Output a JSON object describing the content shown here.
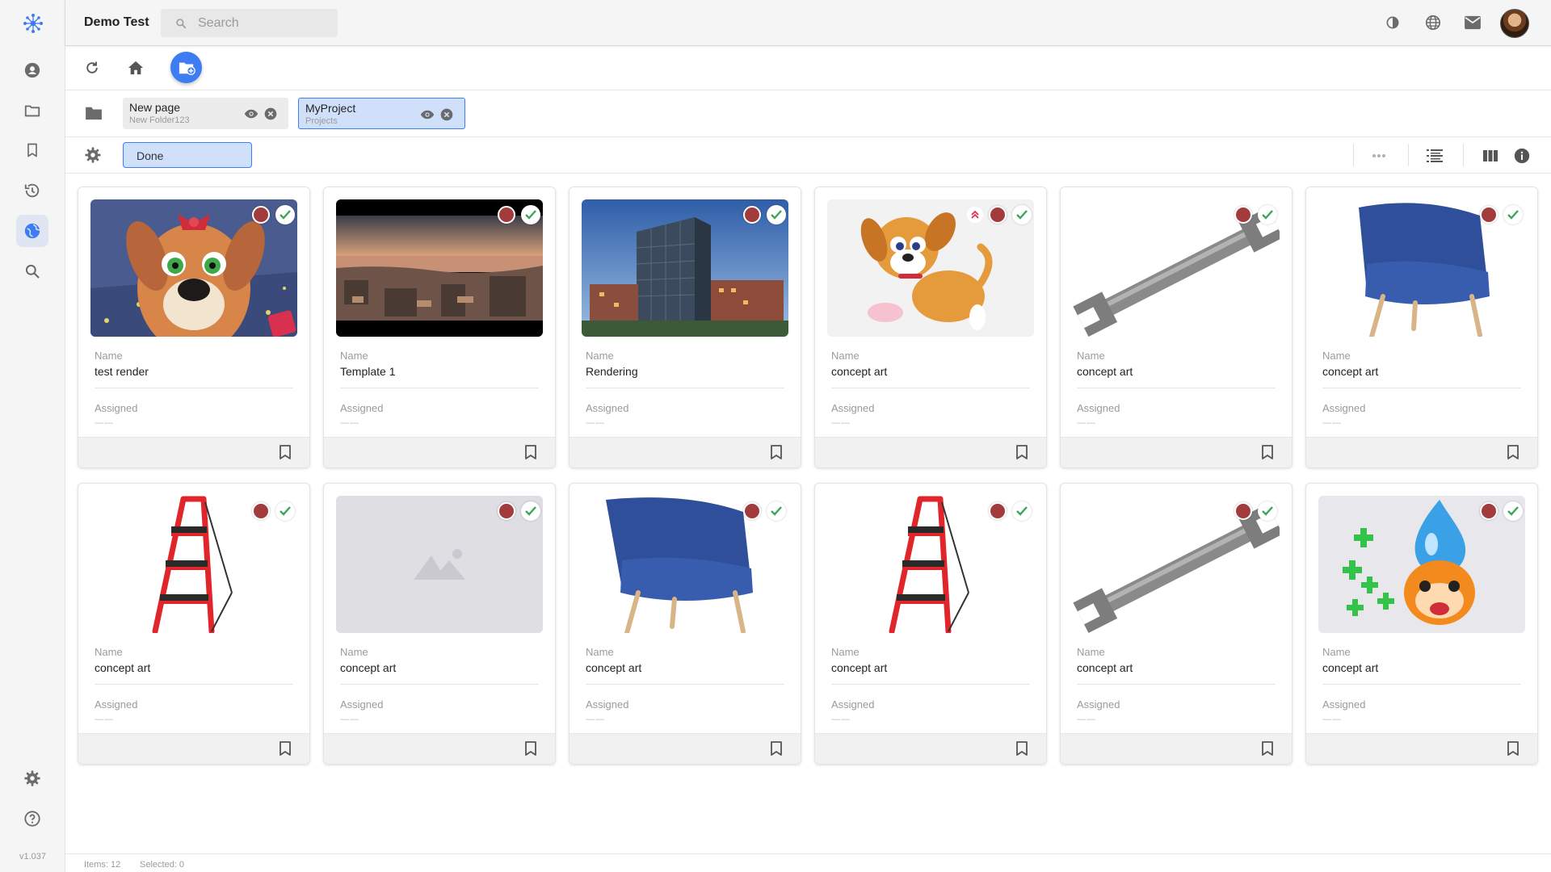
{
  "app": {
    "title": "Demo Test",
    "version": "v1.037"
  },
  "search": {
    "placeholder": "Search"
  },
  "tabs": [
    {
      "title": "New page",
      "subtitle": "New Folder123"
    },
    {
      "title": "MyProject",
      "subtitle": "Projects"
    }
  ],
  "filter": {
    "chip": "Done"
  },
  "cards": [
    {
      "name_label": "Name",
      "name": "test render",
      "assigned_label": "Assigned",
      "assigned": "——"
    },
    {
      "name_label": "Name",
      "name": "Template 1",
      "assigned_label": "Assigned",
      "assigned": "——"
    },
    {
      "name_label": "Name",
      "name": "Rendering",
      "assigned_label": "Assigned",
      "assigned": "——"
    },
    {
      "name_label": "Name",
      "name": "concept art",
      "assigned_label": "Assigned",
      "assigned": "——"
    },
    {
      "name_label": "Name",
      "name": "concept art",
      "assigned_label": "Assigned",
      "assigned": "——"
    },
    {
      "name_label": "Name",
      "name": "concept art",
      "assigned_label": "Assigned",
      "assigned": "——"
    },
    {
      "name_label": "Name",
      "name": "concept art",
      "assigned_label": "Assigned",
      "assigned": "——"
    },
    {
      "name_label": "Name",
      "name": "concept art",
      "assigned_label": "Assigned",
      "assigned": "——"
    },
    {
      "name_label": "Name",
      "name": "concept art",
      "assigned_label": "Assigned",
      "assigned": "——"
    },
    {
      "name_label": "Name",
      "name": "concept art",
      "assigned_label": "Assigned",
      "assigned": "——"
    },
    {
      "name_label": "Name",
      "name": "concept art",
      "assigned_label": "Assigned",
      "assigned": "——"
    },
    {
      "name_label": "Name",
      "name": "concept art",
      "assigned_label": "Assigned",
      "assigned": "——"
    }
  ],
  "statusbar": {
    "items": "Items: 12",
    "selected": "Selected: 0"
  },
  "colors": {
    "accent": "#3d7cf2",
    "status_red": "#a23c3c",
    "check_green": "#3aa657",
    "priority_red": "#d9304f"
  },
  "icons": {
    "rail": [
      "logo-icon",
      "user-icon",
      "folder-icon",
      "bookmark-icon",
      "history-icon",
      "globe-icon",
      "search-icon",
      "settings-icon",
      "help-icon"
    ],
    "topbar": [
      "theme-icon",
      "language-icon",
      "mail-icon",
      "avatar"
    ]
  }
}
